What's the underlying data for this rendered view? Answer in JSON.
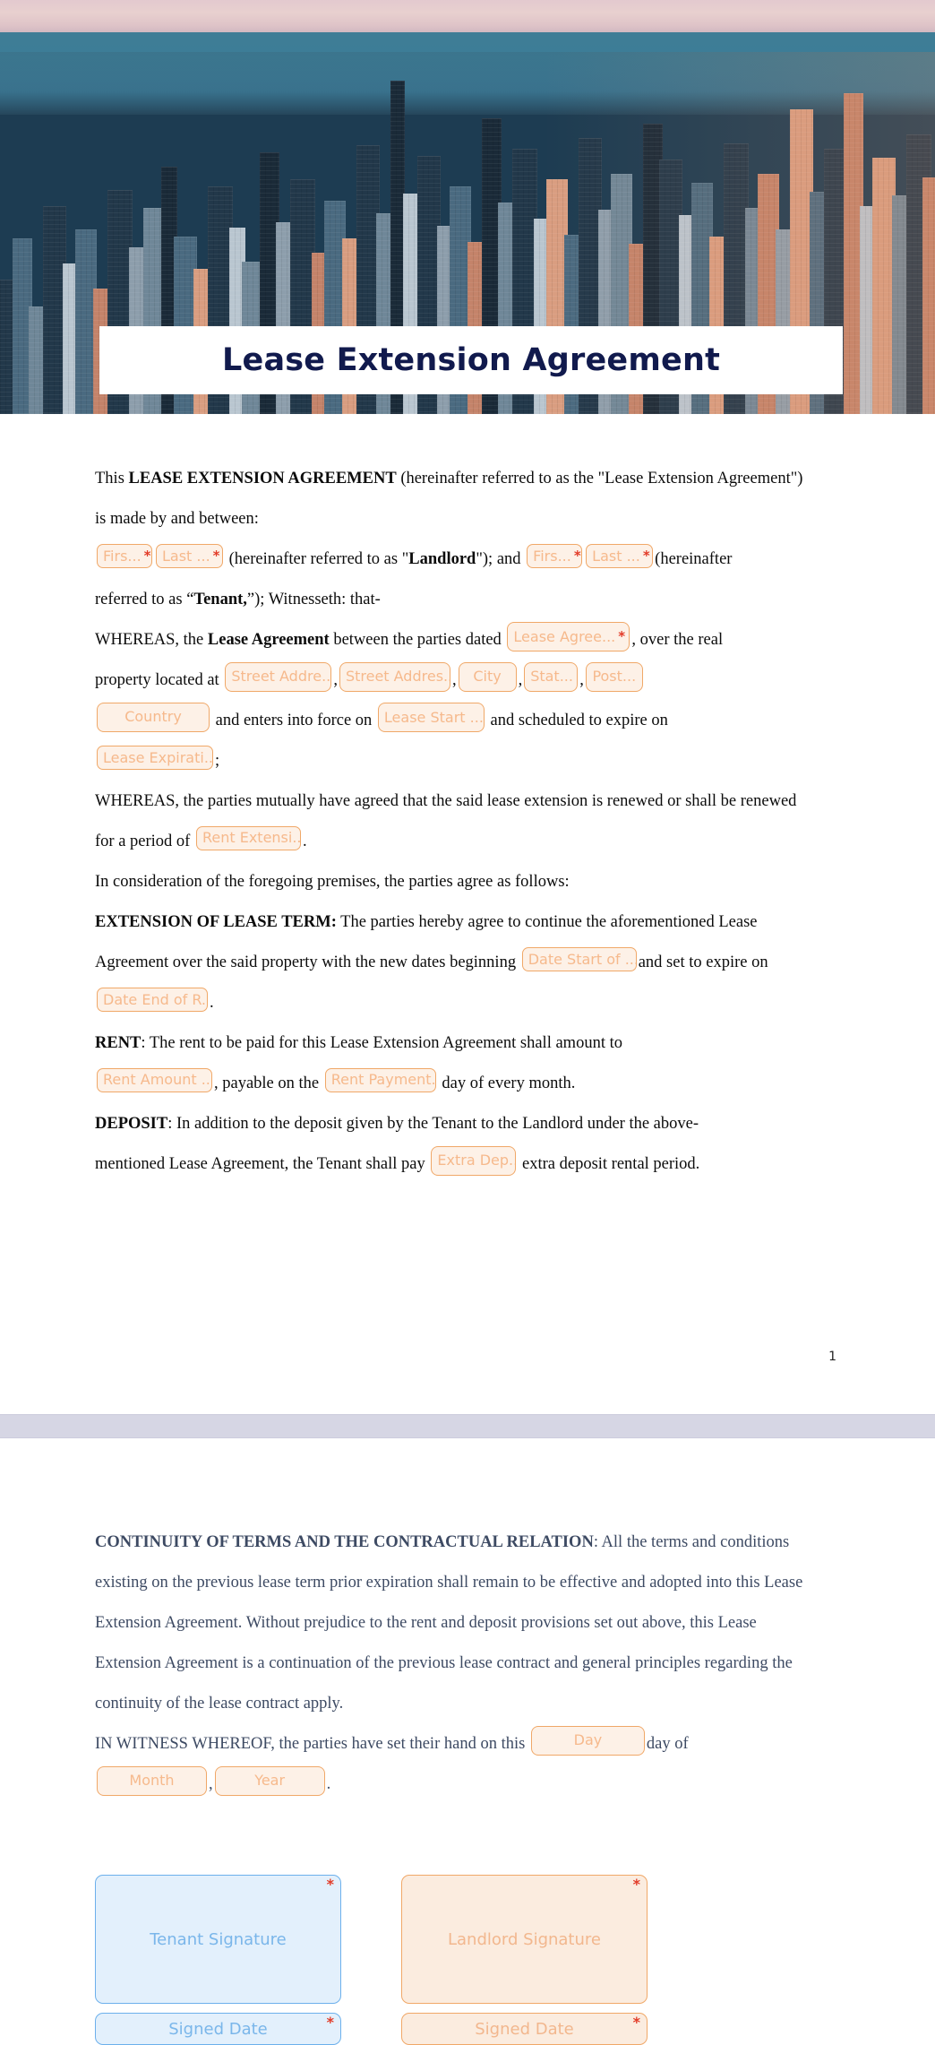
{
  "banner": {
    "title": "Lease Extension Agreement",
    "image_alt": "aerial-cityscape-photo"
  },
  "colors": {
    "field_border": "#f0a868",
    "field_fill": "#fdf1e7",
    "field_text": "#f6b98c",
    "required_star": "#e23b28",
    "tenant_border": "#6cb0ec",
    "tenant_fill": "#e3f0fc",
    "title_text": "#111a4d",
    "page2_text": "#3d4a63",
    "page_break": "#d6d6e4"
  },
  "page1": {
    "p1_a": "This ",
    "p1_b": "LEASE EXTENSION AGREEMENT",
    "p1_c": " (hereinafter referred to as the \"Lease Extension Agreement\")",
    "p2": "is made by and between:",
    "p3_mid": " (hereinafter referred to as \"",
    "p3_landlord": "Landlord",
    "p3_after": "\"); and ",
    "p3_tail": "(hereinafter",
    "p4_a": "referred to as “",
    "p4_tenant": "Tenant,",
    "p4_b": "”); Witnesseth: that-",
    "p5_a": "WHEREAS, the ",
    "p5_b": "Lease Agreement",
    "p5_c": " between the parties dated ",
    "p5_d": ", over the real",
    "p6_a": "property located at ",
    "p7_a": " and enters into force on ",
    "p7_b": " and scheduled to expire on",
    "p8_tail": ";",
    "p9": "WHEREAS, the parties mutually have agreed that the said lease extension is renewed or shall be renewed",
    "p10_a": "for a period of ",
    "p10_b": ".",
    "p11": "In consideration of the foregoing premises, the parties agree as follows:",
    "p12_b": "EXTENSION OF LEASE TERM:",
    "p12_a": " The parties hereby agree to continue the aforementioned Lease",
    "p13_a": "Agreement over the said property with the new dates beginning ",
    "p13_b": "and set to expire on",
    "p14_b": ".",
    "p15_b": "RENT",
    "p15_a": ": The rent to be paid for this Lease Extension Agreement shall amount to",
    "p16_a": ", payable on the ",
    "p16_b": " day of every month.",
    "p17_b": "DEPOSIT",
    "p17_a": ": In addition to the deposit given by the Tenant to the Landlord under the above-",
    "p18_a": "mentioned Lease Agreement, the Tenant  shall pay ",
    "p18_b": " extra deposit rental period.",
    "page_number": "1",
    "fields": {
      "landlord_first": "Firs...",
      "landlord_last": "Last ...",
      "tenant_first": "Firs...",
      "tenant_last": "Last ...",
      "lease_agreement_date": "Lease Agree...",
      "street_address_1": "Street Addre...",
      "street_address_2": "Street Addres...",
      "city": "City",
      "state": "Stat...",
      "postal": "Post...",
      "country": "Country",
      "lease_start": "Lease Start ...",
      "lease_expiration": "Lease Expirati...",
      "rent_extension": "Rent Extensi...",
      "date_start_renewal": "Date Start of ...",
      "date_end_renewal": "Date End of R...",
      "rent_amount": "Rent Amount ...",
      "rent_payment_day": "Rent Payment...",
      "extra_deposit": "Extra Dep...",
      "required_marker": "*"
    }
  },
  "page2": {
    "p1_b": "CONTINUITY OF TERMS AND THE CONTRACTUAL RELATION",
    "p1_a": ": All the terms and conditions",
    "p2": "existing on the previous lease term prior expiration shall remain to be effective and adopted into this Lease",
    "p3": "Extension Agreement. Without prejudice to the rent and deposit provisions set out above, this Lease",
    "p4": "Extension Agreement is a continuation of the previous lease contract and general principles regarding the",
    "p5": "continuity of the lease contract apply.",
    "p6_a": "IN WITNESS WHEREOF, the parties have set their hand on this ",
    "p6_b": "day of",
    "p7_sep": ",",
    "p7_end": ".",
    "fields": {
      "day": "Day",
      "month": "Month",
      "year": "Year",
      "required_marker": "*"
    },
    "signatures": {
      "tenant_signature": "Tenant Signature",
      "tenant_signed_date": "Signed Date",
      "landlord_signature": "Landlord Signature",
      "landlord_signed_date": "Signed Date",
      "required_marker": "*"
    }
  }
}
